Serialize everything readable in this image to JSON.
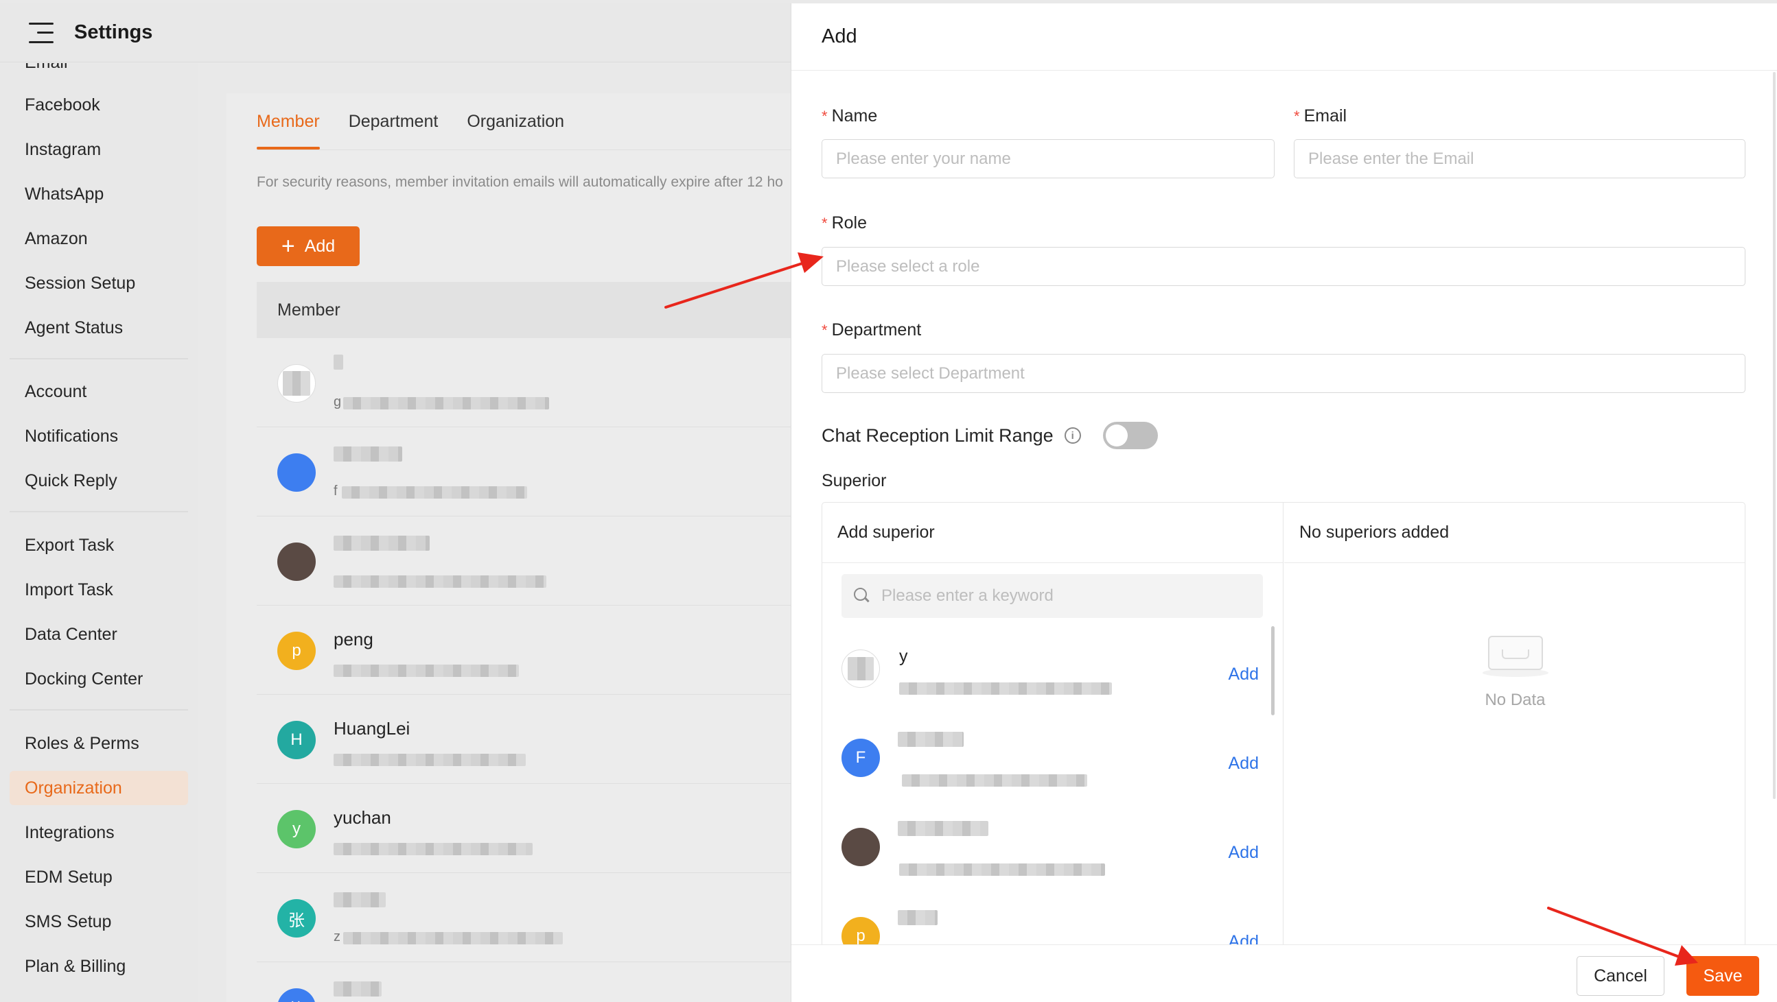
{
  "header": {
    "title": "Settings"
  },
  "sidebar": {
    "items": [
      {
        "label": "Email"
      },
      {
        "label": "Facebook"
      },
      {
        "label": "Instagram"
      },
      {
        "label": "WhatsApp"
      },
      {
        "label": "Amazon"
      },
      {
        "label": "Session Setup"
      },
      {
        "label": "Agent Status"
      },
      {
        "label": "Account"
      },
      {
        "label": "Notifications"
      },
      {
        "label": "Quick Reply"
      },
      {
        "label": "Export Task"
      },
      {
        "label": "Import Task"
      },
      {
        "label": "Data Center"
      },
      {
        "label": "Docking Center"
      },
      {
        "label": "Roles & Perms"
      },
      {
        "label": "Organization"
      },
      {
        "label": "Integrations"
      },
      {
        "label": "EDM Setup"
      },
      {
        "label": "SMS Setup"
      },
      {
        "label": "Plan & Billing"
      }
    ],
    "active": "Organization"
  },
  "main": {
    "tabs": [
      {
        "label": "Member"
      },
      {
        "label": "Department"
      },
      {
        "label": "Organization"
      }
    ],
    "notice": "For security reasons, member invitation emails will automatically expire after 12 ho",
    "add_label": "Add",
    "table_header": "Member",
    "members": [
      {
        "name": "",
        "initial": "",
        "sub": "g",
        "color": "#ffffff"
      },
      {
        "name": "",
        "initial": "",
        "sub": "f",
        "color": "#3d7ef0"
      },
      {
        "name": "",
        "initial": "",
        "sub": "",
        "color": "#5a4a44"
      },
      {
        "name": "peng",
        "initial": "p",
        "sub": "",
        "color": "#f2b01e"
      },
      {
        "name": "HuangLei",
        "initial": "H",
        "sub": "",
        "color": "#23a9a0"
      },
      {
        "name": "yuchan",
        "initial": "y",
        "sub": "",
        "color": "#5cc46a"
      },
      {
        "name": "",
        "initial": "张",
        "sub": "z",
        "color": "#23b3a6"
      },
      {
        "name": "",
        "initial": "徐",
        "sub": "",
        "color": "#3d7ef0"
      }
    ]
  },
  "drawer": {
    "title": "Add",
    "name_label": "Name",
    "name_placeholder": "Please enter your name",
    "email_label": "Email",
    "email_placeholder": "Please enter the Email",
    "role_label": "Role",
    "role_placeholder": "Please select a role",
    "department_label": "Department",
    "department_placeholder": "Please select Department",
    "limit_label": "Chat Reception Limit Range",
    "limit_enabled": false,
    "superior_label": "Superior",
    "add_superior_header": "Add superior",
    "search_placeholder": "Please enter a keyword",
    "no_superiors_header": "No superiors added",
    "empty_text": "No Data",
    "candidates": [
      {
        "name": "y",
        "initial": "",
        "color": "#ffffff",
        "add": "Add"
      },
      {
        "name": "",
        "initial": "F",
        "color": "#3d7ef0",
        "add": "Add"
      },
      {
        "name": "",
        "initial": "",
        "color": "#5a4a44",
        "add": "Add"
      },
      {
        "name": "",
        "initial": "p",
        "color": "#f2b01e",
        "add": "Add"
      }
    ],
    "cancel_label": "Cancel",
    "save_label": "Save"
  },
  "colors": {
    "accent": "#e8691a",
    "save": "#f55a10",
    "link": "#2f74e8",
    "required": "#f04a3e",
    "annotation_arrow": "#e8261c"
  }
}
